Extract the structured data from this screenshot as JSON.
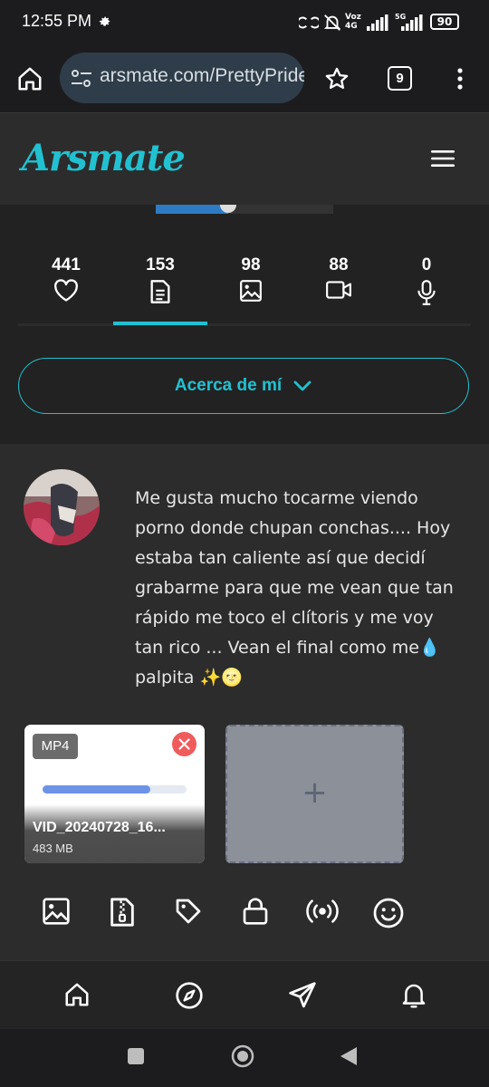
{
  "status_bar": {
    "time": "12:55 PM",
    "carrier_label_1": "Voz",
    "carrier_label_2": "4G",
    "network_label": "5G",
    "battery": "90"
  },
  "browser": {
    "url": "arsmate.com/PrettyPride",
    "tab_count": "9"
  },
  "site": {
    "logo": "Arsmate",
    "accent_color": "#22c1d1"
  },
  "stats": [
    {
      "value": "441",
      "icon": "heart-icon"
    },
    {
      "value": "153",
      "icon": "document-icon"
    },
    {
      "value": "98",
      "icon": "image-icon"
    },
    {
      "value": "88",
      "icon": "video-icon"
    },
    {
      "value": "0",
      "icon": "microphone-icon"
    }
  ],
  "about_button": {
    "label": "Acerca de mí"
  },
  "post": {
    "text": "Me gusta mucho tocarme viendo porno donde chupan conchas.... Hoy estaba tan caliente así que decidí grabarme para que me vean que tan rápido me toco el clítoris y me voy tan rico ... Vean el final como me💧 palpita ✨🌝"
  },
  "attachment": {
    "badge": "MP4",
    "file_name": "VID_20240728_16...",
    "file_size": "483 MB",
    "upload_progress": 0.75
  },
  "add_media": {
    "label": "+"
  },
  "toolbar_icons": [
    "image-icon",
    "zip-file-icon",
    "tag-icon",
    "lock-icon",
    "broadcast-icon",
    "smiley-icon"
  ],
  "bottom_nav_icons": [
    "home-icon",
    "compass-icon",
    "send-icon",
    "bell-icon"
  ]
}
